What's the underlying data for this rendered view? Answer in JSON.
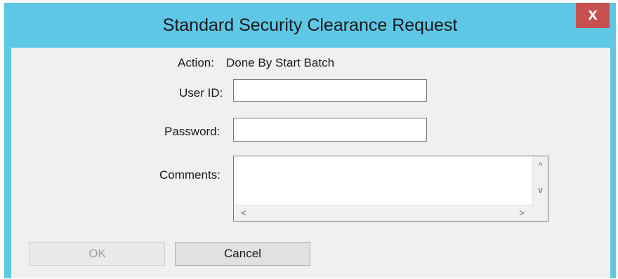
{
  "window": {
    "title": "Standard Security Clearance Request",
    "close_glyph": "x",
    "titlebar_color": "#5fc7e6",
    "close_color": "#c75050"
  },
  "form": {
    "action_label": "Action:",
    "action_value": "Done By Start Batch",
    "user_id_label": "User ID:",
    "user_id_value": "",
    "password_label": "Password:",
    "password_value": "",
    "comments_label": "Comments:",
    "comments_value": ""
  },
  "scrollbars": {
    "up_glyph": "^",
    "down_glyph": "v",
    "left_glyph": "<",
    "right_glyph": ">"
  },
  "buttons": {
    "ok_label": "OK",
    "ok_enabled": false,
    "cancel_label": "Cancel"
  }
}
